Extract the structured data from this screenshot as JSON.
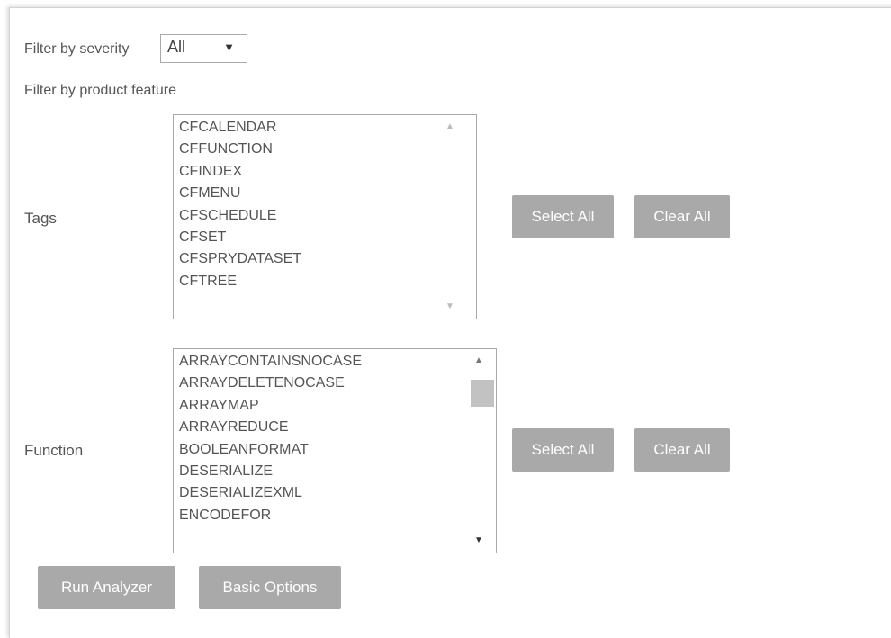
{
  "filter": {
    "severity_label": "Filter by severity",
    "severity_value": "All",
    "product_feature_label": "Filter by product feature"
  },
  "tags": {
    "label": "Tags",
    "items": [
      "CFCALENDAR",
      "CFFUNCTION",
      "CFINDEX",
      "CFMENU",
      "CFSCHEDULE",
      "CFSET",
      "CFSPRYDATASET",
      "CFTREE"
    ],
    "select_all": "Select All",
    "clear_all": "Clear All"
  },
  "function": {
    "label": "Function",
    "items": [
      "ARRAYCONTAINSNOCASE",
      "ARRAYDELETENOCASE",
      "ARRAYMAP",
      "ARRAYREDUCE",
      "BOOLEANFORMAT",
      "DESERIALIZE",
      "DESERIALIZEXML",
      "ENCODEFOR"
    ],
    "select_all": "Select All",
    "clear_all": "Clear All"
  },
  "actions": {
    "run_analyzer": "Run Analyzer",
    "basic_options": "Basic Options"
  },
  "icons": {
    "dropdown": "chevron-down-icon",
    "scroll_up": "scroll-up-arrow-icon",
    "scroll_down": "scroll-down-arrow-icon"
  },
  "colors": {
    "button_bg": "#a9a9a9",
    "button_text": "#ffffff",
    "text": "#555555"
  }
}
